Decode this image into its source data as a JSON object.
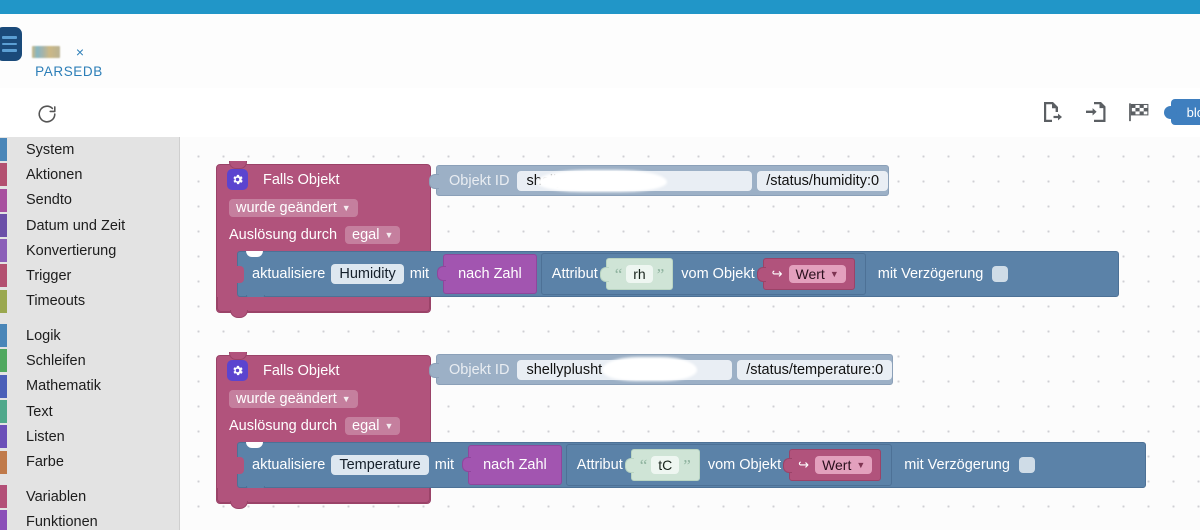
{
  "topbar": {
    "accent_color": "#2196c8"
  },
  "tab": {
    "label": "PARSEDB",
    "close_label": "×",
    "icon": "app-logo-icon"
  },
  "toolbar": {
    "reload_label": "reload-icon",
    "buttons": [
      {
        "name": "export-blocks-icon",
        "label": "Export"
      },
      {
        "name": "import-blocks-icon",
        "label": "Import"
      },
      {
        "name": "checkered-flag-icon",
        "label": "Checkpoint"
      }
    ],
    "blockly_button_label": "blo"
  },
  "sidebar": {
    "groups": [
      {
        "items": [
          {
            "label": "System",
            "color": "#4a86b8"
          },
          {
            "label": "Aktionen",
            "color": "#b35070"
          },
          {
            "label": "Sendto",
            "color": "#a8509f"
          },
          {
            "label": "Datum und Zeit",
            "color": "#6b4fa8"
          },
          {
            "label": "Konvertierung",
            "color": "#8b5fb8"
          },
          {
            "label": "Trigger",
            "color": "#b35070"
          },
          {
            "label": "Timeouts",
            "color": "#9aa84f"
          }
        ]
      },
      {
        "items": [
          {
            "label": "Logik",
            "color": "#4a86b8"
          },
          {
            "label": "Schleifen",
            "color": "#4fa85f"
          },
          {
            "label": "Mathematik",
            "color": "#4a5fb8"
          },
          {
            "label": "Text",
            "color": "#4fa88b"
          },
          {
            "label": "Listen",
            "color": "#6b4fb8"
          },
          {
            "label": "Farbe",
            "color": "#c07a4a"
          }
        ]
      },
      {
        "items": [
          {
            "label": "Variablen",
            "color": "#b35078"
          },
          {
            "label": "Funktionen",
            "color": "#8b4fb8"
          }
        ]
      }
    ]
  },
  "canvas": {
    "blocks": [
      {
        "id": "humidity-trigger",
        "title": "Falls Objekt",
        "gear_icon": "gear-icon",
        "condition": "wurde geändert",
        "trigger_label": "Auslösung durch",
        "trigger_value": "egal",
        "object_id_label": "Objekt ID",
        "object_id_value": "shellyplusht",
        "object_id_suffix": "/status/humidity:0",
        "statement": {
          "action_label": "aktualisiere",
          "target": "Humidity",
          "with_label": "mit",
          "convert": "nach Zahl",
          "attribute_label": "Attribut",
          "attribute_value": "rh",
          "from_label": "vom Objekt",
          "from_value": "Wert",
          "delay_label": "mit Verzögerung",
          "delay_checked": false
        }
      },
      {
        "id": "temperature-trigger",
        "title": "Falls Objekt",
        "gear_icon": "gear-icon",
        "condition": "wurde geändert",
        "trigger_label": "Auslösung durch",
        "trigger_value": "egal",
        "object_id_label": "Objekt ID",
        "object_id_value": "shellyplusht",
        "object_id_suffix": "/status/temperature:0",
        "statement": {
          "action_label": "aktualisiere",
          "target": "Temperature",
          "with_label": "mit",
          "convert": "nach Zahl",
          "attribute_label": "Attribut",
          "attribute_value": "tC",
          "from_label": "vom Objekt",
          "from_value": "Wert",
          "delay_label": "mit Verzögerung",
          "delay_checked": false
        }
      }
    ],
    "quote_open": "“",
    "quote_close": "”",
    "arrow_icon": "↪",
    "caret": "▼"
  }
}
